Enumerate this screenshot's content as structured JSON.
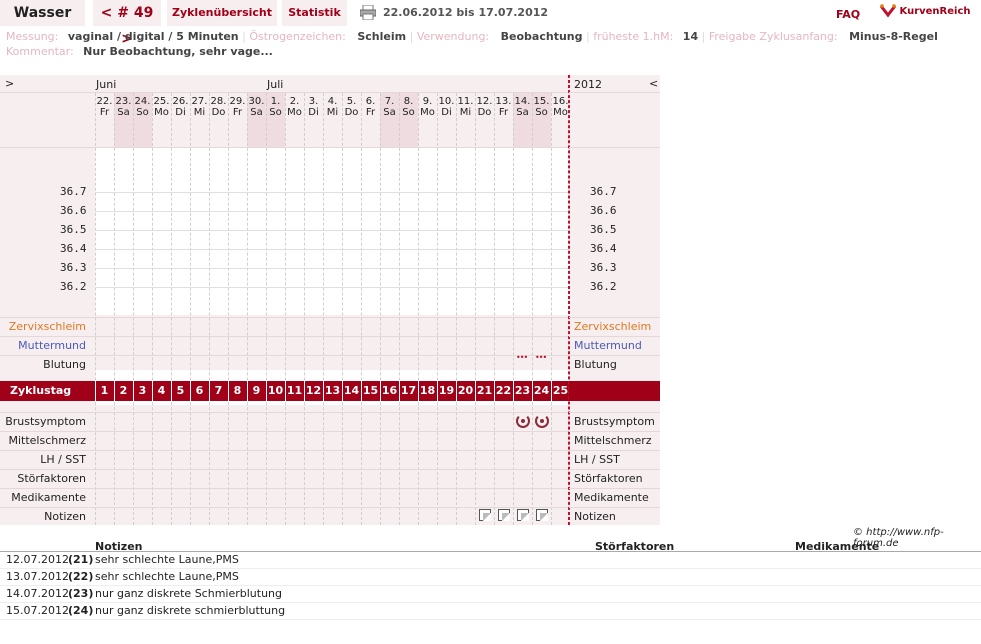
{
  "header": {
    "title": "Wasser",
    "cycle_label": "< # 49 >",
    "tab_overview": "Zyklenübersicht",
    "tab_stats": "Statistik",
    "date_range": "22.06.2012 bis 17.07.2012",
    "faq": "FAQ",
    "brand": "KurvenReich"
  },
  "info": {
    "messung_label": "Messung:",
    "messung_value": "vaginal / digital / 5 Minuten",
    "oestrogen_label": "Östrogenzeichen:",
    "oestrogen_value": "Schleim",
    "verwendung_label": "Verwendung:",
    "verwendung_value": "Beobachtung",
    "fhm_label": "früheste 1.hM:",
    "fhm_value": "14",
    "freigabe_label": "Freigabe Zyklusanfang:",
    "freigabe_value": "Minus-8-Regel",
    "kommentar_label": "Kommentar:",
    "kommentar_value": "Nur Beobachtung, sehr vage..."
  },
  "chart": {
    "nav_left": ">",
    "nav_right": "<",
    "year": "2012",
    "month_juni": "Juni",
    "month_juli": "Juli",
    "days": [
      {
        "d": "22.",
        "w": "Fr"
      },
      {
        "d": "23.",
        "w": "Sa"
      },
      {
        "d": "24.",
        "w": "So"
      },
      {
        "d": "25.",
        "w": "Mo"
      },
      {
        "d": "26.",
        "w": "Di"
      },
      {
        "d": "27.",
        "w": "Mi"
      },
      {
        "d": "28.",
        "w": "Do"
      },
      {
        "d": "29.",
        "w": "Fr"
      },
      {
        "d": "30.",
        "w": "Sa"
      },
      {
        "d": "1.",
        "w": "So"
      },
      {
        "d": "2.",
        "w": "Mo"
      },
      {
        "d": "3.",
        "w": "Di"
      },
      {
        "d": "4.",
        "w": "Mi"
      },
      {
        "d": "5.",
        "w": "Do"
      },
      {
        "d": "6.",
        "w": "Fr"
      },
      {
        "d": "7.",
        "w": "Sa"
      },
      {
        "d": "8.",
        "w": "So"
      },
      {
        "d": "9.",
        "w": "Mo"
      },
      {
        "d": "10.",
        "w": "Di"
      },
      {
        "d": "11.",
        "w": "Mi"
      },
      {
        "d": "12.",
        "w": "Do"
      },
      {
        "d": "13.",
        "w": "Fr"
      },
      {
        "d": "14.",
        "w": "Sa"
      },
      {
        "d": "15.",
        "w": "So"
      },
      {
        "d": "16.",
        "w": "Mo"
      }
    ],
    "temps": [
      "36.7",
      "36.6",
      "36.5",
      "36.4",
      "36.3",
      "36.2"
    ],
    "rows": {
      "zervix": "Zervixschleim",
      "muttermund": "Muttermund",
      "blutung": "Blutung",
      "zyklustag": "Zyklustag",
      "brust": "Brustsymptom",
      "mittel": "Mittelschmerz",
      "lh": "LH / SST",
      "stoer": "Störfaktoren",
      "medi": "Medikamente",
      "notizen": "Notizen"
    },
    "cycle_days": [
      "1",
      "2",
      "3",
      "4",
      "5",
      "6",
      "7",
      "8",
      "9",
      "10",
      "11",
      "12",
      "13",
      "14",
      "15",
      "16",
      "17",
      "18",
      "19",
      "20",
      "21",
      "22",
      "23",
      "24",
      "25"
    ],
    "bleeding_dots": "•••",
    "copyright": "© http://www.nfp-forum.de"
  },
  "notes": {
    "headers": {
      "notizen": "Notizen",
      "stoer": "Störfaktoren",
      "medi": "Medikamente"
    },
    "rows": [
      {
        "date": "12.07.2012",
        "day": "(21)",
        "text": "sehr schlechte Laune,PMS"
      },
      {
        "date": "13.07.2012",
        "day": "(22)",
        "text": "sehr schlechte Laune,PMS"
      },
      {
        "date": "14.07.2012",
        "day": "(23)",
        "text": "nur ganz diskrete Schmierblutung"
      },
      {
        "date": "15.07.2012",
        "day": "(24)",
        "text": "nur ganz diskrete schmierbluttung"
      }
    ]
  },
  "colors": {
    "accent": "#a00018",
    "zervix": "#e07820",
    "muttermund": "#4a5ab8",
    "bg_pink": "#f7eef0"
  }
}
